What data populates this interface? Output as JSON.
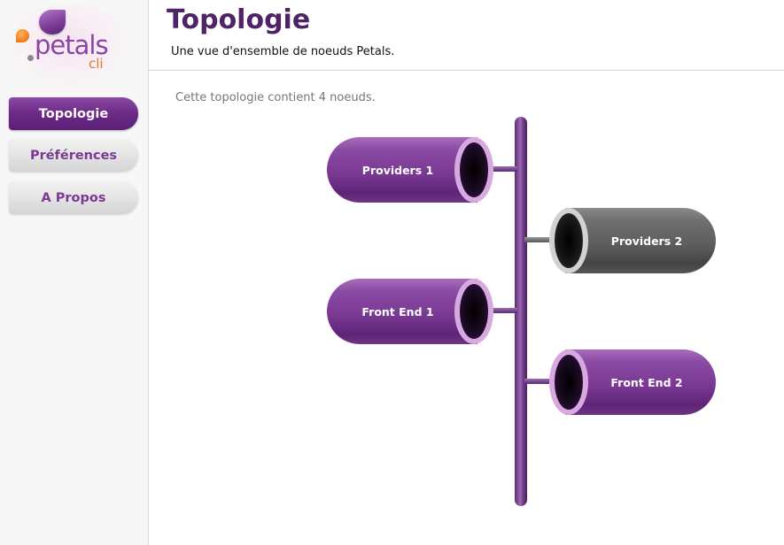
{
  "app": {
    "logo": {
      "word": "petals",
      "suffix": "cli"
    }
  },
  "sidebar": {
    "items": [
      {
        "label": "Topologie",
        "active": true
      },
      {
        "label": "Préférences",
        "active": false
      },
      {
        "label": "A Propos",
        "active": false
      }
    ]
  },
  "header": {
    "title": "Topologie",
    "subtitle": "Une vue d'ensemble de noeuds Petals."
  },
  "main": {
    "summary": "Cette topologie contient 4 noeuds.",
    "nodes": [
      {
        "label": "Providers 1",
        "side": "left",
        "color": "purple"
      },
      {
        "label": "Providers 2",
        "side": "right",
        "color": "grey"
      },
      {
        "label": "Front End 1",
        "side": "left",
        "color": "purple"
      },
      {
        "label": "Front End 2",
        "side": "right",
        "color": "purple"
      }
    ]
  },
  "colors": {
    "brand_purple": "#5c1f78",
    "title_purple": "#4f2367",
    "node_purple": "#7a3a94",
    "node_grey": "#5e5e5e",
    "logo_orange": "#f07a1a"
  }
}
